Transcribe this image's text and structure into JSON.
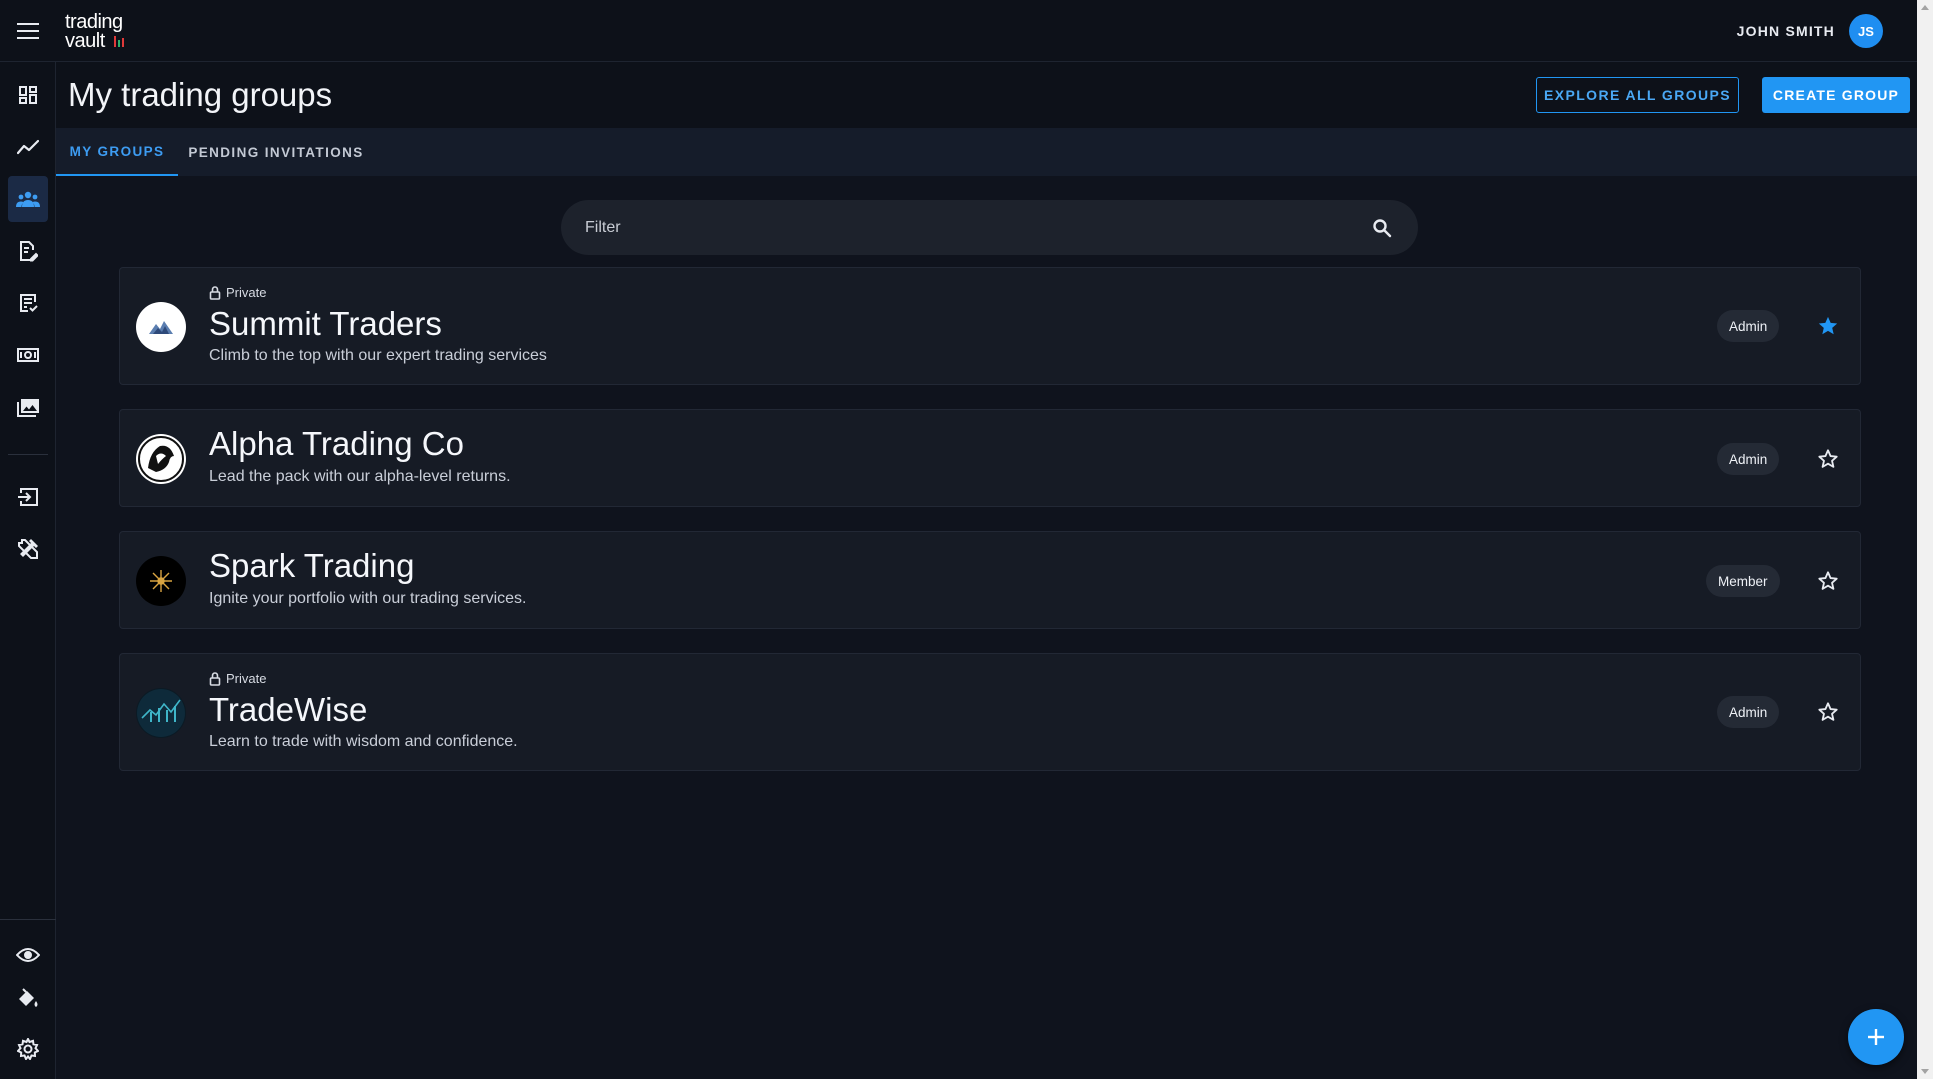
{
  "app": {
    "logo_text_top": "trading",
    "logo_text_bottom": "vault",
    "accent": "#2196f3"
  },
  "user": {
    "name": "JOHN SMITH",
    "initials": "JS"
  },
  "sidebar": {
    "items": [
      {
        "name": "dashboard-icon",
        "active": false
      },
      {
        "name": "trend-chart-icon",
        "active": false
      },
      {
        "name": "groups-icon",
        "active": true
      },
      {
        "name": "edit-document-icon",
        "active": false
      },
      {
        "name": "checklist-icon",
        "active": false
      },
      {
        "name": "cash-icon",
        "active": false
      },
      {
        "name": "photo-library-icon",
        "active": false
      },
      {
        "name": "import-icon",
        "active": false
      },
      {
        "name": "tools-icon",
        "active": false
      },
      {
        "name": "eye-icon",
        "active": false
      },
      {
        "name": "paint-bucket-icon",
        "active": false
      },
      {
        "name": "gear-icon",
        "active": false
      }
    ]
  },
  "header": {
    "title": "My trading groups",
    "explore_label": "EXPLORE ALL GROUPS",
    "create_label": "CREATE GROUP"
  },
  "tabs": [
    {
      "label": "MY GROUPS",
      "active": true
    },
    {
      "label": "PENDING INVITATIONS",
      "active": false
    }
  ],
  "filter": {
    "placeholder": "Filter",
    "value": ""
  },
  "groups": [
    {
      "private_label": "Private",
      "name": "Summit Traders",
      "description": "Climb to the top with our expert trading services",
      "role": "Admin",
      "favorite": true
    },
    {
      "private_label": "",
      "name": "Alpha Trading Co",
      "description": "Lead the pack with our alpha-level returns.",
      "role": "Admin",
      "favorite": false
    },
    {
      "private_label": "",
      "name": "Spark Trading",
      "description": "Ignite your portfolio with our trading services.",
      "role": "Member",
      "favorite": false
    },
    {
      "private_label": "Private",
      "name": "TradeWise",
      "description": "Learn to trade with wisdom and confidence.",
      "role": "Admin",
      "favorite": false
    }
  ]
}
